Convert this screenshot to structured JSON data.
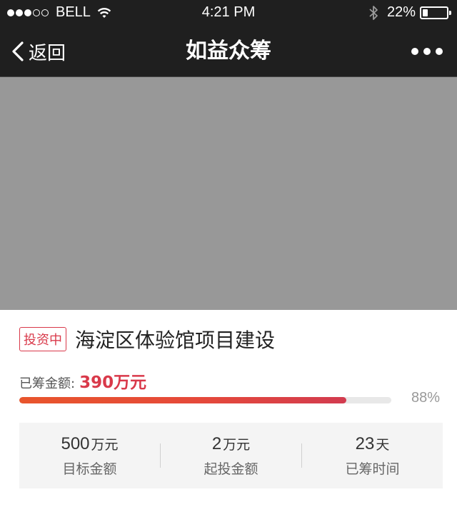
{
  "status_bar": {
    "carrier": "BELL",
    "signal_full": 3,
    "signal_total": 5,
    "time": "4:21 PM",
    "battery_text": "22%",
    "battery_level": 0.22,
    "icons": [
      "signal-icon",
      "wifi-icon",
      "bluetooth-icon",
      "battery-icon"
    ]
  },
  "navbar": {
    "back_label": "返回",
    "title": "如益众筹",
    "icons": [
      "back-chevron-icon",
      "more-icon"
    ]
  },
  "banner": {
    "color": "#989898"
  },
  "project": {
    "badge": "投资中",
    "title": "海淀区体验馆项目建设",
    "raised_label": "已筹金额:",
    "raised_value": "390万元",
    "progress_text": "88%",
    "progress": 0.88
  },
  "stats": [
    {
      "number": "500",
      "unit": "万元",
      "label": "目标金额"
    },
    {
      "number": "2",
      "unit": "万元",
      "label": "起投金额"
    },
    {
      "number": "23",
      "unit": "天",
      "label": "已筹时间"
    }
  ],
  "colors": {
    "accent": "#d9394a",
    "progress_start": "#e8552c",
    "progress_end": "#d23b4f",
    "bar_background": "#1f1f1f"
  }
}
